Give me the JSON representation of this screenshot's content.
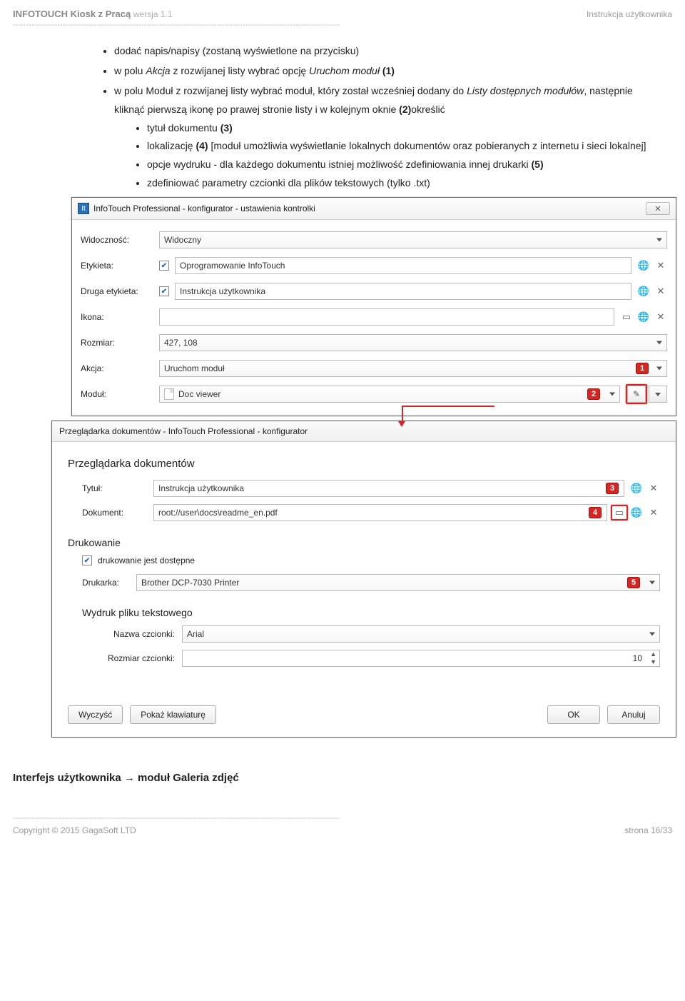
{
  "header": {
    "title_strong": "INFOTOUCH Kiosk z Pracą",
    "version": "wersja 1.1",
    "subtitle": "Instrukcja użytkownika"
  },
  "bullets": {
    "b1_a": "dodać napis/napisy (zostaną wyświetlone na przycisku)",
    "b2_pre": "w polu ",
    "b2_it": "Akcja",
    "b2_mid": " z rozwijanej listy wybrać opcję ",
    "b2_it2": "Uruchom moduł",
    "b2_tag": " (1)",
    "b3_pre": "w polu Moduł z rozwijanej listy wybrać moduł, który został wcześniej dodany do ",
    "b3_it": "Listy dostępnych modułów",
    "b3_mid": ", następnie kliknąć pierwszą ikonę po prawej stronie listy i w kolejnym oknie ",
    "b3_b": "(2)",
    "b3_post": "określić",
    "s1_a": "tytuł dokumentu ",
    "s1_b": "(3)",
    "s2_a": "lokalizację ",
    "s2_b": "(4)",
    "s2_c": " [moduł umożliwia wyświetlanie lokalnych dokumentów oraz pobieranych z internetu i sieci lokalnej]",
    "s3_a": "opcje wydruku - dla każdego dokumentu istniej możliwość zdefiniowania innej drukarki ",
    "s3_b": "(5)",
    "s4": "zdefiniować parametry czcionki dla plików tekstowych (tylko .txt)"
  },
  "win1": {
    "title": "InfoTouch Professional - konfigurator - ustawienia kontrolki",
    "rows": {
      "widocznosc_lbl": "Widoczność:",
      "widocznosc_val": "Widoczny",
      "etykieta_lbl": "Etykieta:",
      "etykieta_val": "Oprogramowanie InfoTouch",
      "etykieta2_lbl": "Druga etykieta:",
      "etykieta2_val": "Instrukcja użytkownika",
      "ikona_lbl": "Ikona:",
      "ikona_val": "",
      "rozmiar_lbl": "Rozmiar:",
      "rozmiar_val": "427, 108",
      "akcja_lbl": "Akcja:",
      "akcja_val": "Uruchom moduł",
      "modul_lbl": "Moduł:",
      "modul_val": "Doc viewer"
    },
    "tags": {
      "t1": "1",
      "t2": "2"
    }
  },
  "win2": {
    "title": "Przeglądarka dokumentów - InfoTouch Professional - konfigurator",
    "section1": "Przeglądarka dokumentów",
    "tytul_lbl": "Tytuł:",
    "tytul_val": "Instrukcja użytkownika",
    "dokument_lbl": "Dokument:",
    "dokument_val": "root://user\\docs\\readme_en.pdf",
    "section2": "Drukowanie",
    "chk_label": "drukowanie jest dostępne",
    "drukarka_lbl": "Drukarka:",
    "drukarka_val": "Brother DCP-7030 Printer",
    "section3": "Wydruk pliku tekstowego",
    "font_lbl": "Nazwa czcionki:",
    "font_val": "Arial",
    "size_lbl": "Rozmiar czcionki:",
    "size_val": "10",
    "tags": {
      "t3": "3",
      "t4": "4",
      "t5": "5"
    },
    "buttons": {
      "clear": "Wyczyść",
      "kbd": "Pokaż klawiaturę",
      "ok": "OK",
      "cancel": "Anuluj"
    }
  },
  "bottom_heading_a": "Interfejs użytkownika ",
  "bottom_heading_arrow": "→",
  "bottom_heading_b": " moduł Galeria zdjęć",
  "footer": {
    "copyright": "Copyright © 2015 GagaSoft LTD",
    "page": "strona 16/33"
  }
}
